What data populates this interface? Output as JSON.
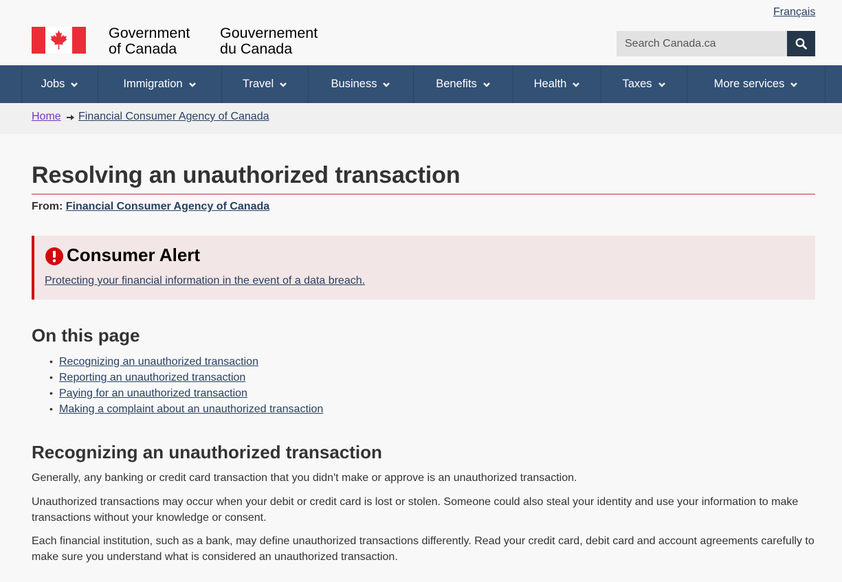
{
  "header": {
    "lang_link": "Français",
    "gov_name_en_line1": "Government",
    "gov_name_en_line2": "of Canada",
    "gov_name_fr_line1": "Gouvernement",
    "gov_name_fr_line2": "du Canada",
    "search_placeholder": "Search Canada.ca",
    "flag_icon": "canada-flag-icon",
    "search_icon": "search-icon"
  },
  "nav": {
    "items": [
      {
        "label": "Jobs"
      },
      {
        "label": "Immigration"
      },
      {
        "label": "Travel"
      },
      {
        "label": "Business"
      },
      {
        "label": "Benefits"
      },
      {
        "label": "Health"
      },
      {
        "label": "Taxes"
      },
      {
        "label": "More services"
      }
    ]
  },
  "breadcrumb": {
    "home": "Home",
    "current": "Financial Consumer Agency of Canada"
  },
  "page": {
    "title": "Resolving an unauthorized transaction",
    "from_label": "From:",
    "from_link": "Financial Consumer Agency of Canada"
  },
  "alert": {
    "title": "Consumer Alert",
    "link": "Protecting your financial information in the event of a data breach."
  },
  "on_this_page": {
    "heading": "On this page",
    "items": [
      "Recognizing an unauthorized transaction",
      "Reporting an unauthorized transaction",
      "Paying for an unauthorized transaction",
      "Making a complaint about an unauthorized transaction"
    ]
  },
  "section_recognizing": {
    "heading": "Recognizing an unauthorized transaction",
    "p1": "Generally, any banking or credit card transaction that you didn't make or approve is an unauthorized transaction.",
    "p2": "Unauthorized transactions may occur when your debit or credit card is lost or stolen. Someone could also steal your identity and use your information to make transactions without your knowledge or consent.",
    "p3": "Each financial institution, such as a bank, may define unauthorized transactions differently. Read your credit card, debit card and account agreements carefully to make sure you understand what is considered an unauthorized transaction."
  },
  "colors": {
    "nav_bg": "#335075",
    "search_button": "#26374a",
    "link": "#284162",
    "visited_link": "#7834bc",
    "alert_bg": "#f3e6e6",
    "alert_border": "#d3080c",
    "title_rule": "#af3c43"
  }
}
